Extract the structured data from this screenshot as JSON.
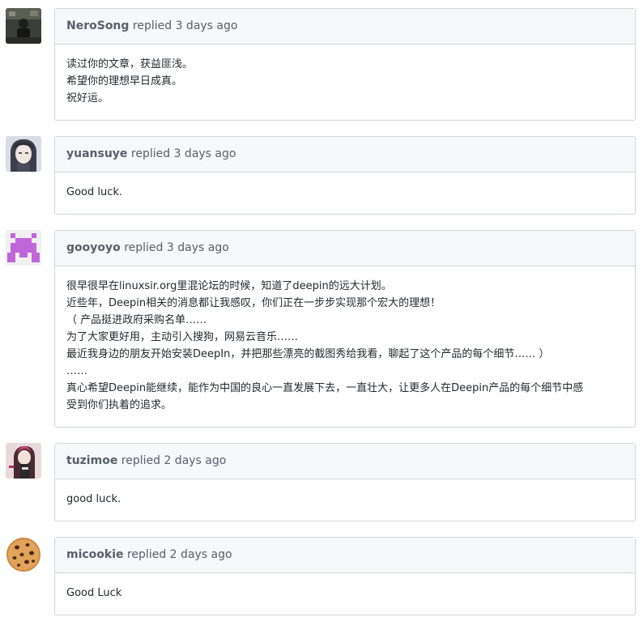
{
  "comments": [
    {
      "author": "NeroSong",
      "meta": "replied 3 days ago",
      "avatar_icon": "photo-avatar-dark",
      "lines": [
        "读过你的文章，获益匪浅。",
        "希望你的理想早日成真。",
        "祝好运。"
      ]
    },
    {
      "author": "yuansuye",
      "meta": "replied 3 days ago",
      "avatar_icon": "anime-avatar",
      "lines": [
        "Good luck."
      ]
    },
    {
      "author": "gooyoyo",
      "meta": "replied 3 days ago",
      "avatar_icon": "identicon-purple",
      "lines": [
        "很早很早在linuxsir.org里混论坛的时候，知道了deepin的远大计划。",
        "近些年，Deepin相关的消息都让我感叹，你们正在一步步实现那个宏大的理想！",
        "（ 产品挺进政府采购名单……",
        "为了大家更好用，主动引入搜狗，网易云音乐……",
        "最近我身边的朋友开始安装DeepIn，并把那些漂亮的截图秀给我看，聊起了这个产品的每个细节……  ）",
        "……",
        "真心希望Deepin能继续，能作为中国的良心一直发展下去，一直壮大，让更多人在Deepin产品的每个细节中感",
        "受到你们执着的追求。"
      ]
    },
    {
      "author": "tuzimoe",
      "meta": "replied 2 days ago",
      "avatar_icon": "anime-girl-avatar",
      "lines": [
        "good luck."
      ]
    },
    {
      "author": "micookie",
      "meta": "replied 2 days ago",
      "avatar_icon": "cookie-avatar",
      "lines": [
        "Good Luck"
      ]
    }
  ],
  "colors": {
    "border": "#d1d5da",
    "header_bg": "#f6f8fa",
    "meta_text": "#586069",
    "body_text": "#24292e",
    "identicon": "#c066d8"
  }
}
